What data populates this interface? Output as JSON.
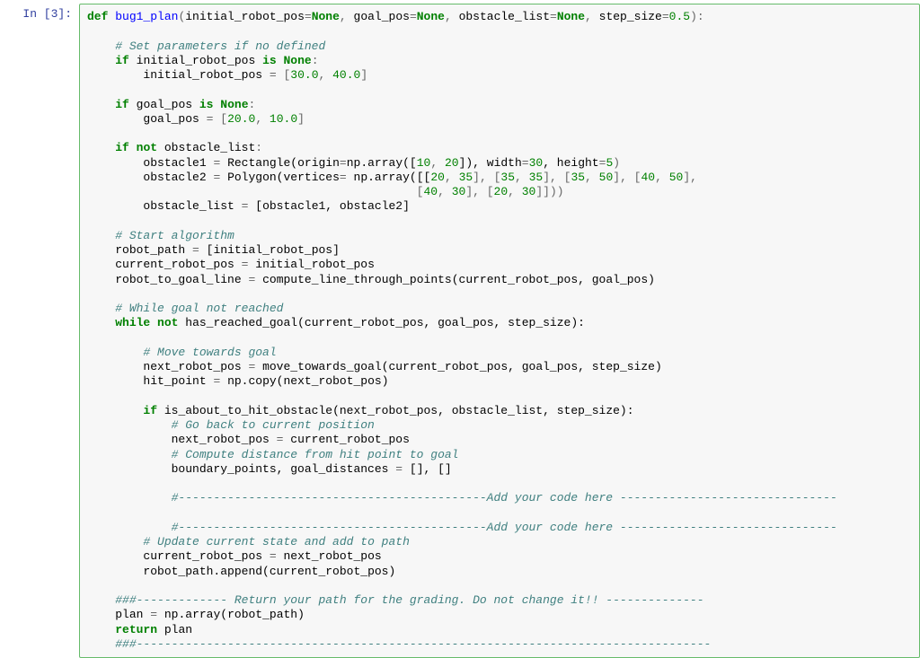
{
  "prompt": "In [3]:",
  "code": {
    "t01_kw_def": "def",
    "t01_fn": "bug1_plan",
    "t01_p_initial": "initial_robot_pos",
    "t01_kw_none1": "None",
    "t01_p_goal": "goal_pos",
    "t01_kw_none2": "None",
    "t01_p_obst": "obstacle_list",
    "t01_kw_none3": "None",
    "t01_p_step": "step_size",
    "t01_step_val": "0.5",
    "t03_cm": "# Set parameters if no defined",
    "t04_kw_if": "if",
    "t04_nm": "initial_robot_pos",
    "t04_kw_is": "is",
    "t04_none": "None",
    "t05_nm": "initial_robot_pos",
    "t05_v1": "30.0",
    "t05_v2": "40.0",
    "t07_kw_if": "if",
    "t07_nm": "goal_pos",
    "t07_kw_is": "is",
    "t07_none": "None",
    "t08_nm": "goal_pos",
    "t08_v1": "20.0",
    "t08_v2": "10.0",
    "t10_kw_if": "if",
    "t10_kw_not": "not",
    "t10_nm": "obstacle_list",
    "t11_nm_obs1": "obstacle1",
    "t11_rect": "Rectangle(origin",
    "t11_nparr": "np.array([",
    "t11_v1": "10",
    "t11_v2": "20",
    "t11_post1": "]), width",
    "t11_w": "30",
    "t11_post2": ", height",
    "t11_h": "5",
    "t12_nm_obs2": "obstacle2",
    "t12_poly": "Polygon(vertices",
    "t12_nparr": " np.array([[",
    "t12_a": "20",
    "t12_b": "35",
    "t12_c": "35",
    "t12_d": "35",
    "t12_e": "35",
    "t12_f": "50",
    "t12_g": "40",
    "t12_h": "50",
    "t13_a": "40",
    "t13_b": "30",
    "t13_c": "20",
    "t13_d": "30",
    "t14_nm": "obstacle_list",
    "t14_list": "[obstacle1, obstacle2]",
    "t16_cm": "# Start algorithm",
    "t17_nm": "robot_path",
    "t17_val": "[initial_robot_pos]",
    "t18_nm": "current_robot_pos",
    "t18_val": "initial_robot_pos",
    "t19_nm": "robot_to_goal_line",
    "t19_val": "compute_line_through_points(current_robot_pos, goal_pos)",
    "t21_cm": "# While goal not reached",
    "t22_kw_while": "while",
    "t22_kw_not": "not",
    "t22_call": "has_reached_goal(current_robot_pos, goal_pos, step_size):",
    "t24_cm": "# Move towards goal",
    "t25_nm": "next_robot_pos",
    "t25_val": "move_towards_goal(current_robot_pos, goal_pos, step_size)",
    "t26_nm": "hit_point",
    "t26_val": "np.copy(next_robot_pos)",
    "t28_kw_if": "if",
    "t28_call": "is_about_to_hit_obstacle(next_robot_pos, obstacle_list, step_size):",
    "t29_cm": "# Go back to current position",
    "t30_nm": "next_robot_pos",
    "t30_val": "current_robot_pos",
    "t31_cm": "# Compute distance from hit point to goal",
    "t32_nm": "boundary_points, goal_distances",
    "t32_val": "[], []",
    "t34_cm": "#--------------------------------------------Add your code here -------------------------------",
    "t36_cm": "#--------------------------------------------Add your code here -------------------------------",
    "t37_cm": "# Update current state and add to path",
    "t38_nm": "current_robot_pos",
    "t38_val": "next_robot_pos",
    "t39_nm": "robot_path.append(current_robot_pos)",
    "t41_cm": "###------------- Return your path for the grading. Do not change it!! --------------",
    "t42_nm": "plan",
    "t42_val": "np.array(robot_path)",
    "t43_kw_return": "return",
    "t43_nm": "plan",
    "t44_cm": "###----------------------------------------------------------------------------------"
  }
}
